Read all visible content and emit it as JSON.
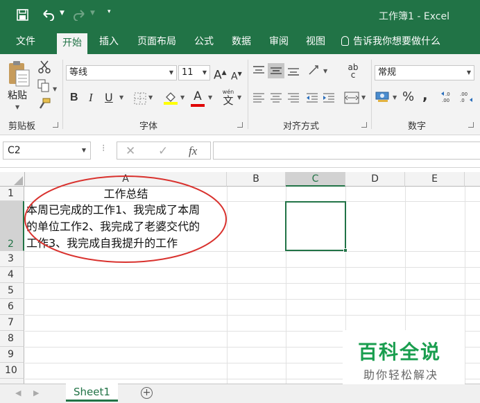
{
  "app": {
    "window_title": "工作簿1  -  Excel",
    "quick_access": {
      "save_icon": "save-icon",
      "undo_icon": "undo-icon",
      "redo_icon": "redo-icon",
      "customize_icon": "chevron-down-icon"
    }
  },
  "menu": {
    "tabs": [
      "文件",
      "开始",
      "插入",
      "页面布局",
      "公式",
      "数据",
      "审阅",
      "视图"
    ],
    "active_tab": "开始",
    "tell_me": "告诉我你想要做什么"
  },
  "ribbon": {
    "clipboard": {
      "label": "剪贴板",
      "paste_label": "粘贴"
    },
    "font": {
      "label": "字体",
      "family": "等线",
      "size": "11",
      "bold": "B",
      "italic": "I",
      "underline": "U",
      "grow": "A",
      "shrink": "A",
      "font_color": "A",
      "phonetic_top": "wén",
      "phonetic_bottom": "文"
    },
    "alignment": {
      "label": "对齐方式",
      "wrap": "ab",
      "wrap2": "c"
    },
    "number": {
      "label": "数字",
      "format": "常规",
      "percent": "%",
      "comma": ","
    }
  },
  "formula_bar": {
    "name_box": "C2",
    "cancel": "✕",
    "enter": "✓",
    "fx": "fx",
    "value": ""
  },
  "grid": {
    "columns": [
      "A",
      "B",
      "C",
      "D",
      "E"
    ],
    "selected_column": "C",
    "rows": [
      "1",
      "2",
      "3",
      "4",
      "5",
      "6",
      "7",
      "8",
      "9",
      "10"
    ],
    "cells": {
      "A1": "工作总结",
      "A2_lines": [
        "本周已完成的工作1、我完成了本周",
        "的单位工作2、我完成了老婆交代的",
        "工作3、我完成自我提升的工作"
      ]
    },
    "active_cell": "C2",
    "annotation_color": "#d9322e"
  },
  "sheets": {
    "tabs": [
      "Sheet1"
    ],
    "active": "Sheet1",
    "add_label": "+"
  },
  "watermark": {
    "title": "百科全说",
    "subtitle": "助你轻松解决",
    "color": "#1a9e4f"
  }
}
